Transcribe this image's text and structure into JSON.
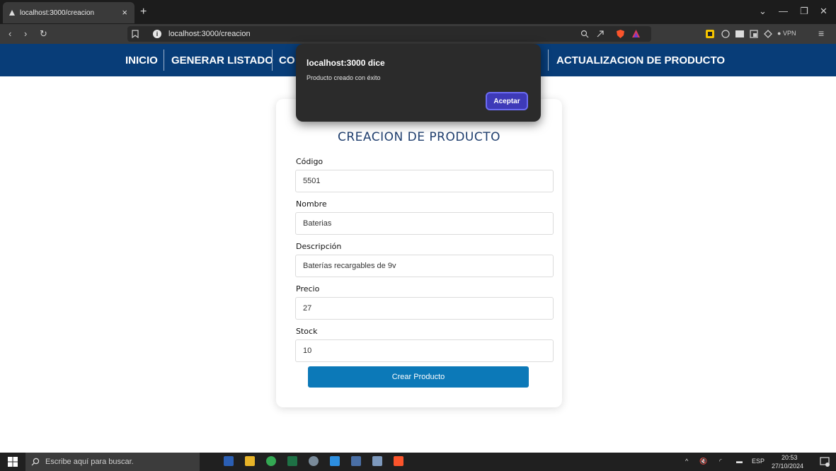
{
  "browser": {
    "tab_title": "localhost:3000/creacion",
    "tab_close": "×",
    "new_tab": "+",
    "url": "localhost:3000/creacion",
    "vpn": "VPN"
  },
  "site_nav": {
    "items": [
      "INICIO",
      "GENERAR LISTADO",
      "CO",
      "ACTUALIZACION DE PRODUCTO"
    ]
  },
  "form": {
    "title": "CREACION DE PRODUCTO",
    "fields": [
      {
        "label": "Código",
        "value": "5501"
      },
      {
        "label": "Nombre",
        "value": "Baterias"
      },
      {
        "label": "Descripción",
        "value": "Baterías recargables de 9v"
      },
      {
        "label": "Precio",
        "value": "27"
      },
      {
        "label": "Stock",
        "value": "10"
      }
    ],
    "submit_label": "Crear Producto"
  },
  "dialog": {
    "title": "localhost:3000 dice",
    "message": "Producto creado con éxito",
    "ok_label": "Aceptar"
  },
  "taskbar": {
    "search_placeholder": "Escribe aquí para buscar.",
    "lang": "ESP",
    "time": "20:53",
    "date": "27/10/2024"
  },
  "colors": {
    "nav_bg": "#083d78",
    "button_bg": "#0c79b8",
    "dialog_button": "#3e3ab8"
  }
}
